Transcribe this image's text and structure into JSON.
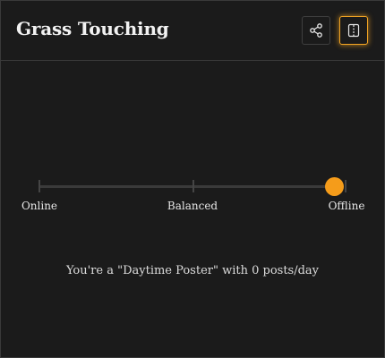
{
  "header": {
    "title": "Grass Touching",
    "share_icon": "share-icon",
    "split_icon": "split-view-icon"
  },
  "slider": {
    "stops": [
      {
        "label": "Online"
      },
      {
        "label": "Balanced"
      },
      {
        "label": "Offline"
      }
    ],
    "selected_index": 2,
    "value_fraction": 1.0
  },
  "result": {
    "text": "You're a \"Daytime Poster\" with 0 posts/day"
  },
  "colors": {
    "accent": "#f59c1a",
    "background": "#1b1b1b",
    "border": "#3a3a3a",
    "title_text": "#f2f2f2"
  }
}
